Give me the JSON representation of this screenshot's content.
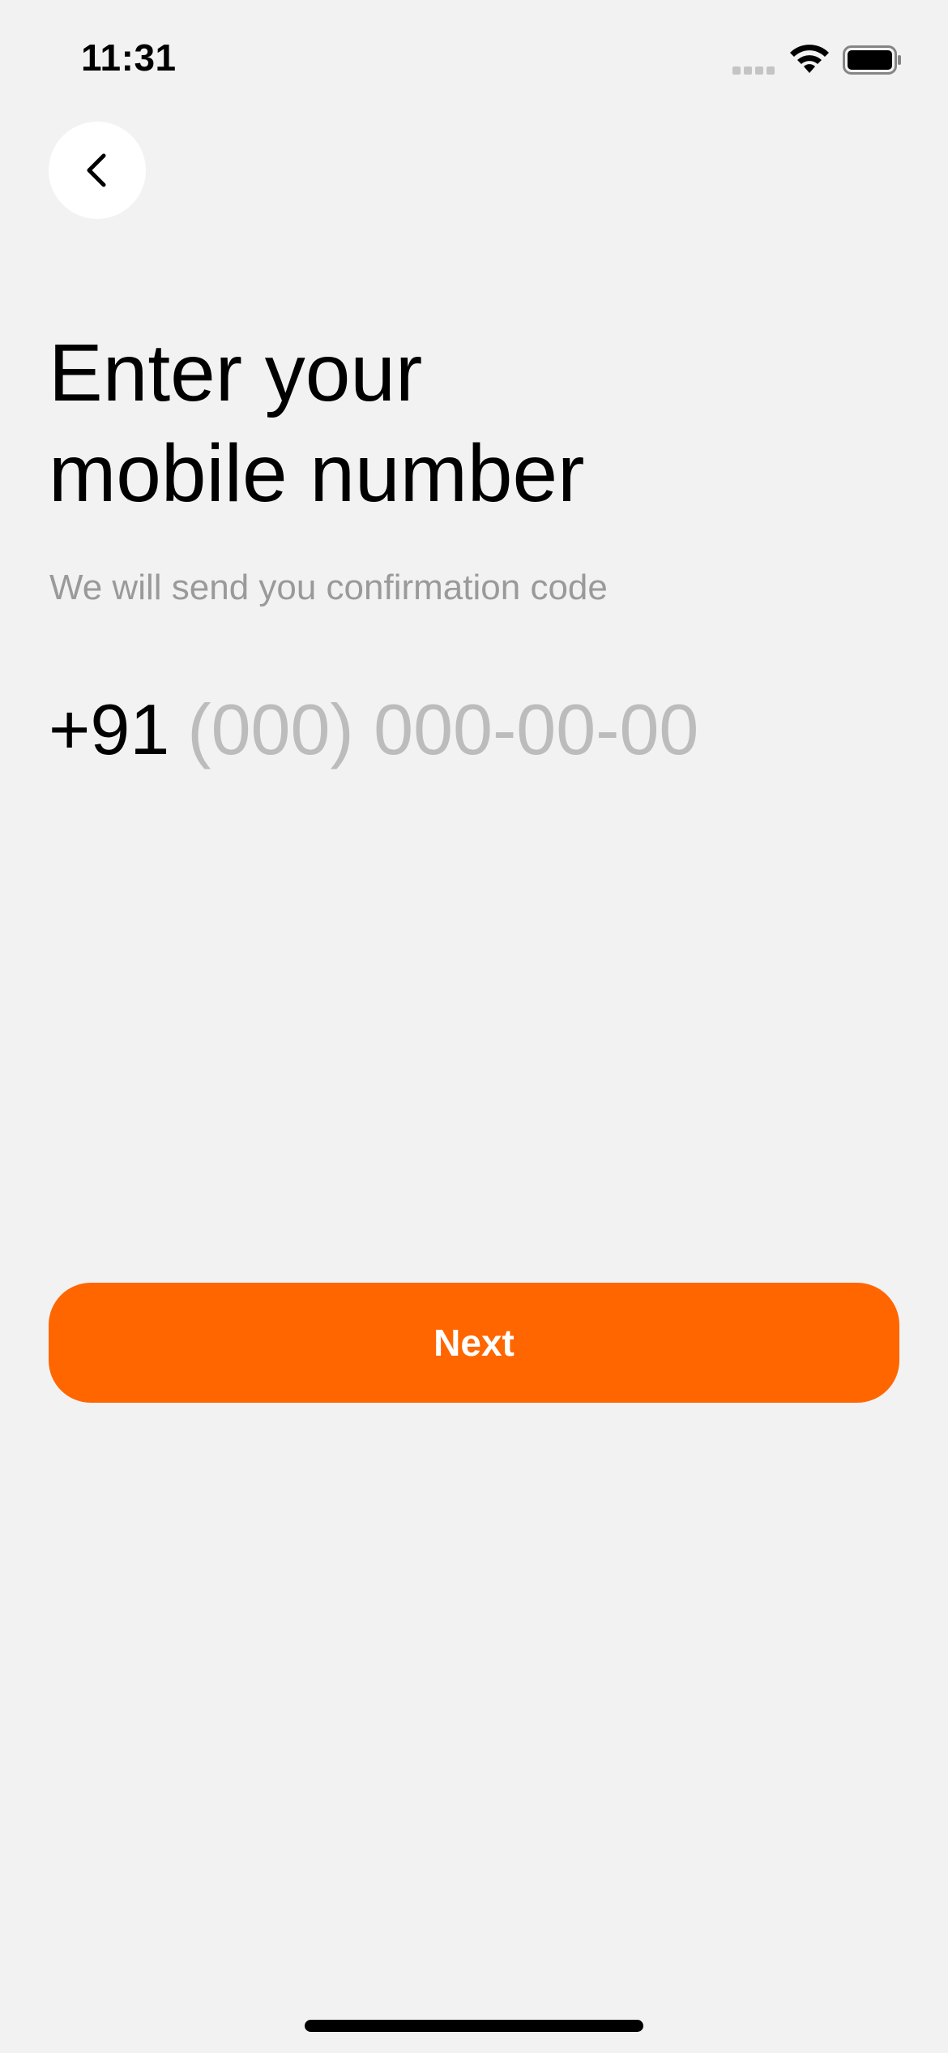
{
  "status_bar": {
    "time": "11:31",
    "icons": [
      "signal-icon",
      "wifi-icon",
      "battery-icon"
    ]
  },
  "header": {
    "back_icon": "chevron-left-icon"
  },
  "main": {
    "title_line1": "Enter your",
    "title_line2": "mobile number",
    "subtitle": "We will send you confirmation code",
    "country_code": "+91",
    "phone_placeholder": "(000) 000-00-00",
    "phone_value": ""
  },
  "footer": {
    "next_label": "Next"
  },
  "colors": {
    "background": "#f2f2f2",
    "accent": "#ff6600",
    "placeholder": "#bcbcbc",
    "subtitle": "#9a9a9a"
  }
}
